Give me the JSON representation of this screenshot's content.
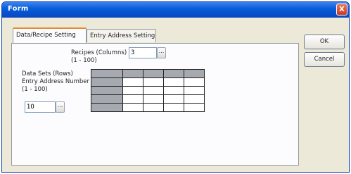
{
  "window": {
    "title": "Form",
    "close_glyph": "X"
  },
  "tabs": [
    {
      "label": "Data/Recipe Setting",
      "active": true
    },
    {
      "label": "Entry Address Setting",
      "active": false
    }
  ],
  "recipes": {
    "label": "Recipes (Columns)",
    "range": "(1 - 100)",
    "value": "3",
    "browse": "..."
  },
  "datasets": {
    "label_line1": "Data Sets (Rows)",
    "label_line2": "Entry Address Number",
    "range": "(1 - 100)",
    "value": "10",
    "browse": "..."
  },
  "grid": {
    "rows": 5,
    "cols": 5
  },
  "buttons": {
    "ok": "OK",
    "cancel": "Cancel"
  },
  "colors": {
    "titlebar": "#0550d0",
    "dialog_bg": "#ece9d8",
    "grid_header": "#a6a9b0",
    "tab_highlight": "#e68b2c"
  }
}
